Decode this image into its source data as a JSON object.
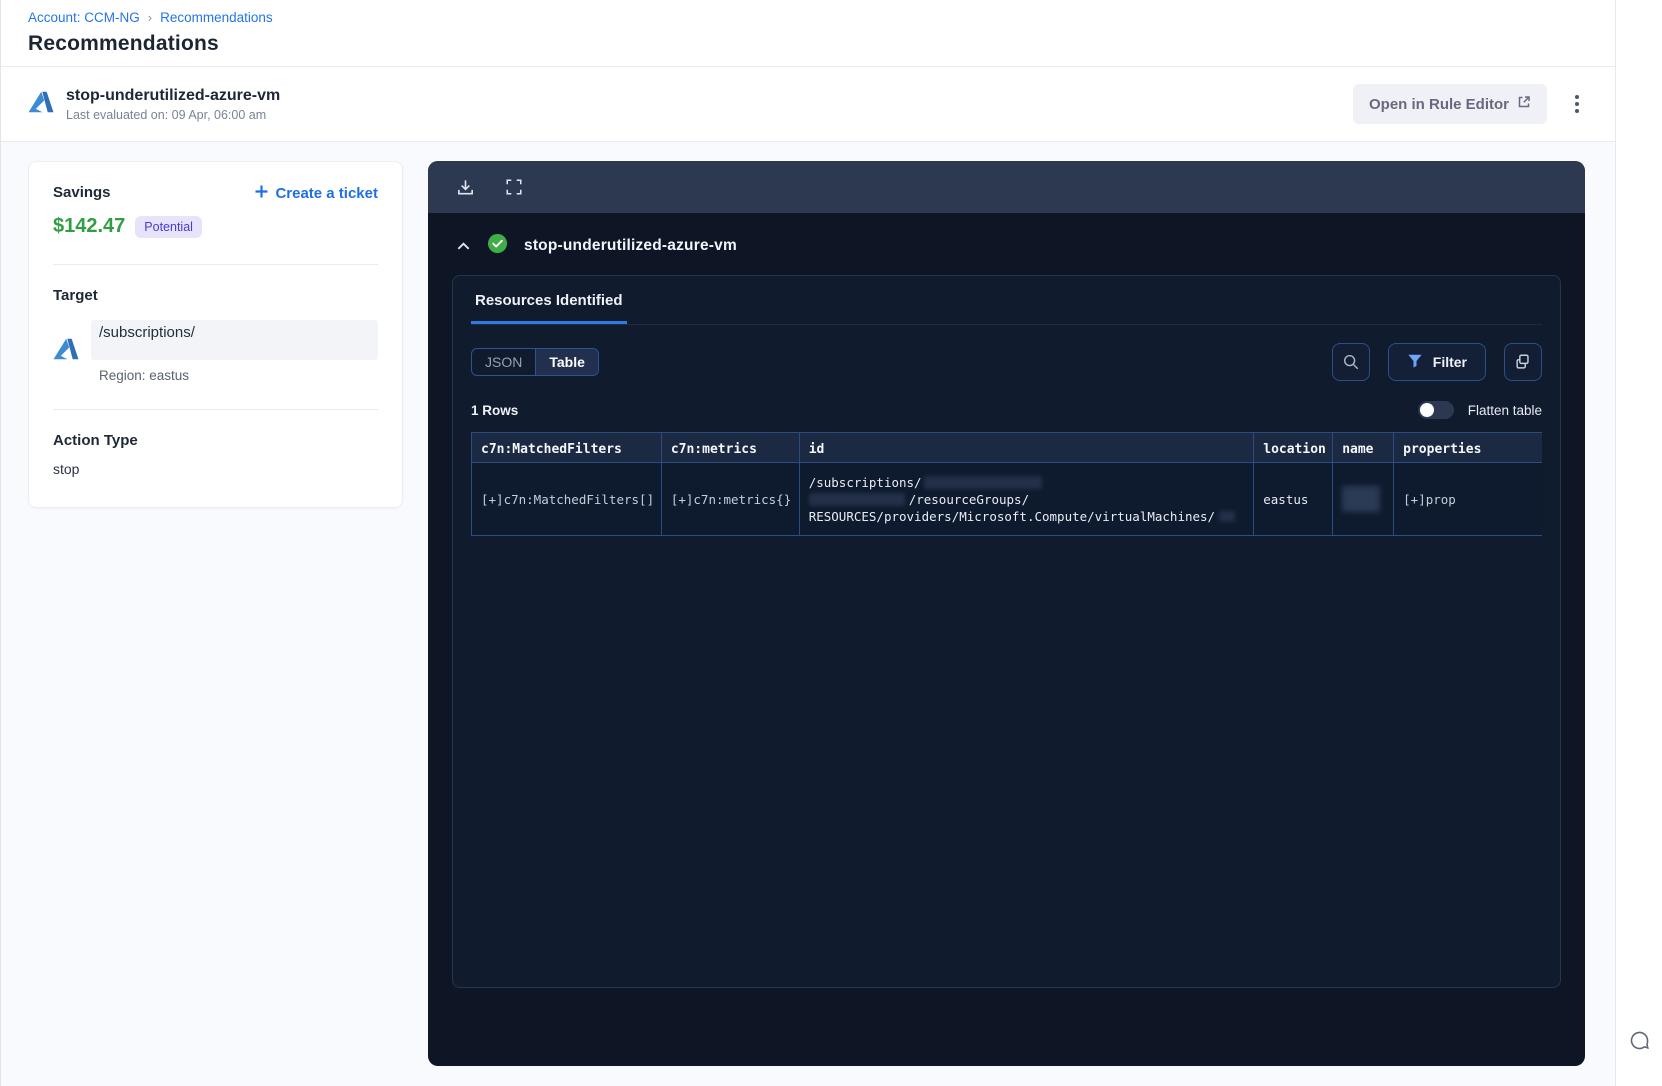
{
  "breadcrumb": {
    "account": "Account: CCM-NG",
    "separator": "›",
    "current": "Recommendations"
  },
  "page": {
    "title": "Recommendations"
  },
  "rule_header": {
    "name": "stop-underutilized-azure-vm",
    "last_evaluated": "Last evaluated on: 09 Apr, 06:00 am",
    "open_button_label": "Open in Rule Editor"
  },
  "savings_card": {
    "savings_label": "Savings",
    "amount": "$142.47",
    "badge": "Potential",
    "create_ticket_label": "Create a ticket",
    "target_label": "Target",
    "target_path": "/subscriptions/",
    "region": "Region: eastus",
    "action_type_label": "Action Type",
    "action_type_value": "stop"
  },
  "panel": {
    "rule_name": "stop-underutilized-azure-vm",
    "tab_label": "Resources Identified",
    "view_toggle": {
      "json": "JSON",
      "table": "Table"
    },
    "filter_label": "Filter",
    "rows_count": "1 Rows",
    "flatten_label": "Flatten table",
    "table": {
      "columns": [
        "c7n:MatchedFilters",
        "c7n:metrics",
        "id",
        "location",
        "name",
        "properties"
      ],
      "row": {
        "matched_filters": "[+]c7n:MatchedFilters[]",
        "metrics": "[+]c7n:metrics{}",
        "id_line1": "/subscriptions/",
        "id_line2": "/resourceGroups/",
        "id_line3": "RESOURCES/providers/Microsoft.Compute/virtualMachines/",
        "location": "eastus",
        "properties": "[+]prop"
      }
    }
  },
  "colors": {
    "link_blue": "#2476e8",
    "savings_green": "#2f9e44",
    "badge_purple_bg": "#e7e3fb",
    "badge_purple_text": "#4a3ad0",
    "panel_bg": "#0e1626",
    "panel_toolbar_bg": "#2c3950",
    "table_border_blue": "#2d4b7e",
    "tab_underline_blue": "#2f7ae5",
    "check_green": "#3fae49"
  }
}
